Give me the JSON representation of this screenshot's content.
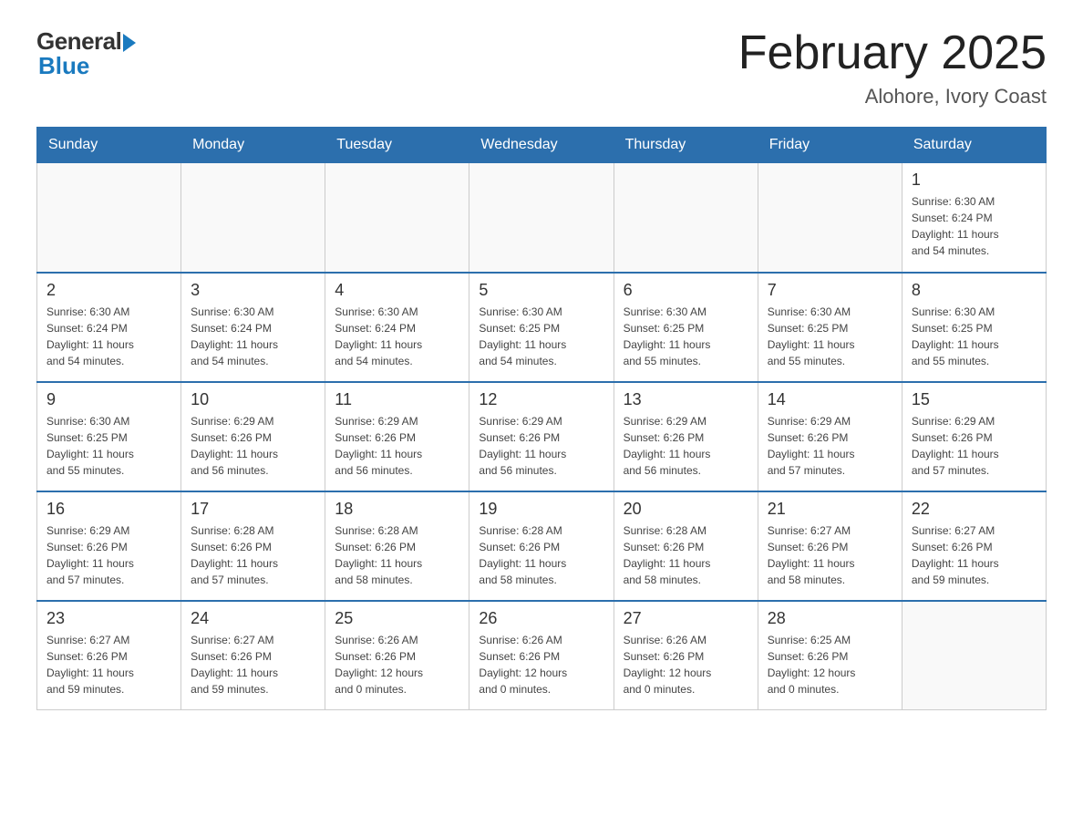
{
  "header": {
    "logo_general": "General",
    "logo_blue": "Blue",
    "title": "February 2025",
    "subtitle": "Alohore, Ivory Coast"
  },
  "weekdays": [
    "Sunday",
    "Monday",
    "Tuesday",
    "Wednesday",
    "Thursday",
    "Friday",
    "Saturday"
  ],
  "weeks": [
    [
      {
        "day": "",
        "info": ""
      },
      {
        "day": "",
        "info": ""
      },
      {
        "day": "",
        "info": ""
      },
      {
        "day": "",
        "info": ""
      },
      {
        "day": "",
        "info": ""
      },
      {
        "day": "",
        "info": ""
      },
      {
        "day": "1",
        "info": "Sunrise: 6:30 AM\nSunset: 6:24 PM\nDaylight: 11 hours\nand 54 minutes."
      }
    ],
    [
      {
        "day": "2",
        "info": "Sunrise: 6:30 AM\nSunset: 6:24 PM\nDaylight: 11 hours\nand 54 minutes."
      },
      {
        "day": "3",
        "info": "Sunrise: 6:30 AM\nSunset: 6:24 PM\nDaylight: 11 hours\nand 54 minutes."
      },
      {
        "day": "4",
        "info": "Sunrise: 6:30 AM\nSunset: 6:24 PM\nDaylight: 11 hours\nand 54 minutes."
      },
      {
        "day": "5",
        "info": "Sunrise: 6:30 AM\nSunset: 6:25 PM\nDaylight: 11 hours\nand 54 minutes."
      },
      {
        "day": "6",
        "info": "Sunrise: 6:30 AM\nSunset: 6:25 PM\nDaylight: 11 hours\nand 55 minutes."
      },
      {
        "day": "7",
        "info": "Sunrise: 6:30 AM\nSunset: 6:25 PM\nDaylight: 11 hours\nand 55 minutes."
      },
      {
        "day": "8",
        "info": "Sunrise: 6:30 AM\nSunset: 6:25 PM\nDaylight: 11 hours\nand 55 minutes."
      }
    ],
    [
      {
        "day": "9",
        "info": "Sunrise: 6:30 AM\nSunset: 6:25 PM\nDaylight: 11 hours\nand 55 minutes."
      },
      {
        "day": "10",
        "info": "Sunrise: 6:29 AM\nSunset: 6:26 PM\nDaylight: 11 hours\nand 56 minutes."
      },
      {
        "day": "11",
        "info": "Sunrise: 6:29 AM\nSunset: 6:26 PM\nDaylight: 11 hours\nand 56 minutes."
      },
      {
        "day": "12",
        "info": "Sunrise: 6:29 AM\nSunset: 6:26 PM\nDaylight: 11 hours\nand 56 minutes."
      },
      {
        "day": "13",
        "info": "Sunrise: 6:29 AM\nSunset: 6:26 PM\nDaylight: 11 hours\nand 56 minutes."
      },
      {
        "day": "14",
        "info": "Sunrise: 6:29 AM\nSunset: 6:26 PM\nDaylight: 11 hours\nand 57 minutes."
      },
      {
        "day": "15",
        "info": "Sunrise: 6:29 AM\nSunset: 6:26 PM\nDaylight: 11 hours\nand 57 minutes."
      }
    ],
    [
      {
        "day": "16",
        "info": "Sunrise: 6:29 AM\nSunset: 6:26 PM\nDaylight: 11 hours\nand 57 minutes."
      },
      {
        "day": "17",
        "info": "Sunrise: 6:28 AM\nSunset: 6:26 PM\nDaylight: 11 hours\nand 57 minutes."
      },
      {
        "day": "18",
        "info": "Sunrise: 6:28 AM\nSunset: 6:26 PM\nDaylight: 11 hours\nand 58 minutes."
      },
      {
        "day": "19",
        "info": "Sunrise: 6:28 AM\nSunset: 6:26 PM\nDaylight: 11 hours\nand 58 minutes."
      },
      {
        "day": "20",
        "info": "Sunrise: 6:28 AM\nSunset: 6:26 PM\nDaylight: 11 hours\nand 58 minutes."
      },
      {
        "day": "21",
        "info": "Sunrise: 6:27 AM\nSunset: 6:26 PM\nDaylight: 11 hours\nand 58 minutes."
      },
      {
        "day": "22",
        "info": "Sunrise: 6:27 AM\nSunset: 6:26 PM\nDaylight: 11 hours\nand 59 minutes."
      }
    ],
    [
      {
        "day": "23",
        "info": "Sunrise: 6:27 AM\nSunset: 6:26 PM\nDaylight: 11 hours\nand 59 minutes."
      },
      {
        "day": "24",
        "info": "Sunrise: 6:27 AM\nSunset: 6:26 PM\nDaylight: 11 hours\nand 59 minutes."
      },
      {
        "day": "25",
        "info": "Sunrise: 6:26 AM\nSunset: 6:26 PM\nDaylight: 12 hours\nand 0 minutes."
      },
      {
        "day": "26",
        "info": "Sunrise: 6:26 AM\nSunset: 6:26 PM\nDaylight: 12 hours\nand 0 minutes."
      },
      {
        "day": "27",
        "info": "Sunrise: 6:26 AM\nSunset: 6:26 PM\nDaylight: 12 hours\nand 0 minutes."
      },
      {
        "day": "28",
        "info": "Sunrise: 6:25 AM\nSunset: 6:26 PM\nDaylight: 12 hours\nand 0 minutes."
      },
      {
        "day": "",
        "info": ""
      }
    ]
  ]
}
